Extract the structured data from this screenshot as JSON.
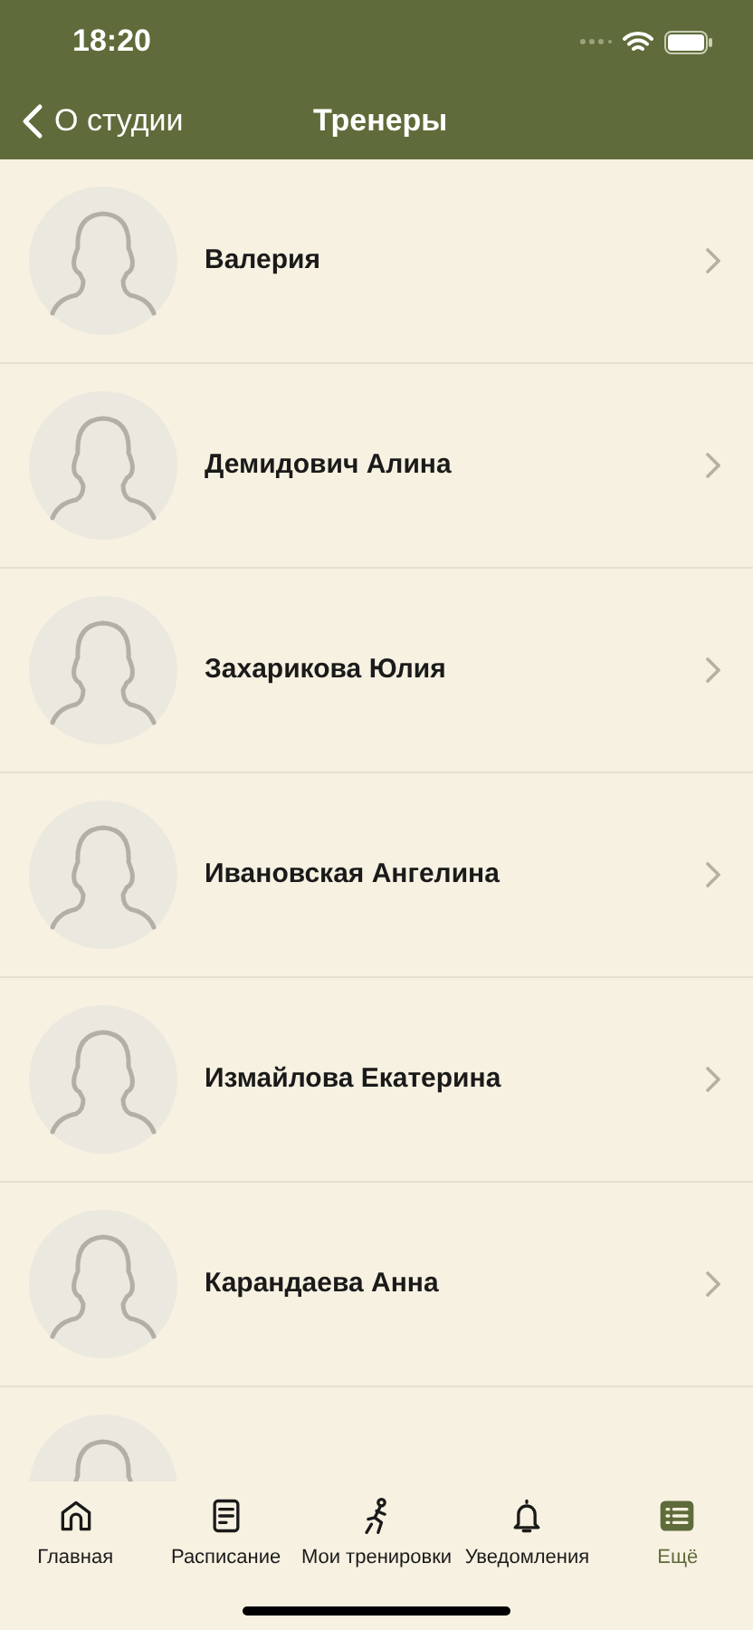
{
  "status_bar": {
    "time": "18:20"
  },
  "nav": {
    "back_label": "О студии",
    "title": "Тренеры"
  },
  "trainers": [
    {
      "kind": "full",
      "name": "Валерия"
    },
    {
      "kind": "full",
      "name": "Демидович Алина"
    },
    {
      "kind": "full",
      "name": "Захарикова Юлия"
    },
    {
      "kind": "full",
      "name": "Ивановская Ангелина"
    },
    {
      "kind": "full",
      "name": "Измайлова Екатерина"
    },
    {
      "kind": "full",
      "name": "Карандаева Анна"
    },
    {
      "kind": "cut"
    }
  ],
  "tab_bar": [
    {
      "label": "Главная",
      "selected": false
    },
    {
      "label": "Расписание",
      "selected": false
    },
    {
      "label": "Мои тренировки",
      "selected": false
    },
    {
      "label": "Уведомления",
      "selected": false
    },
    {
      "label": "Ещё",
      "selected": true
    }
  ]
}
